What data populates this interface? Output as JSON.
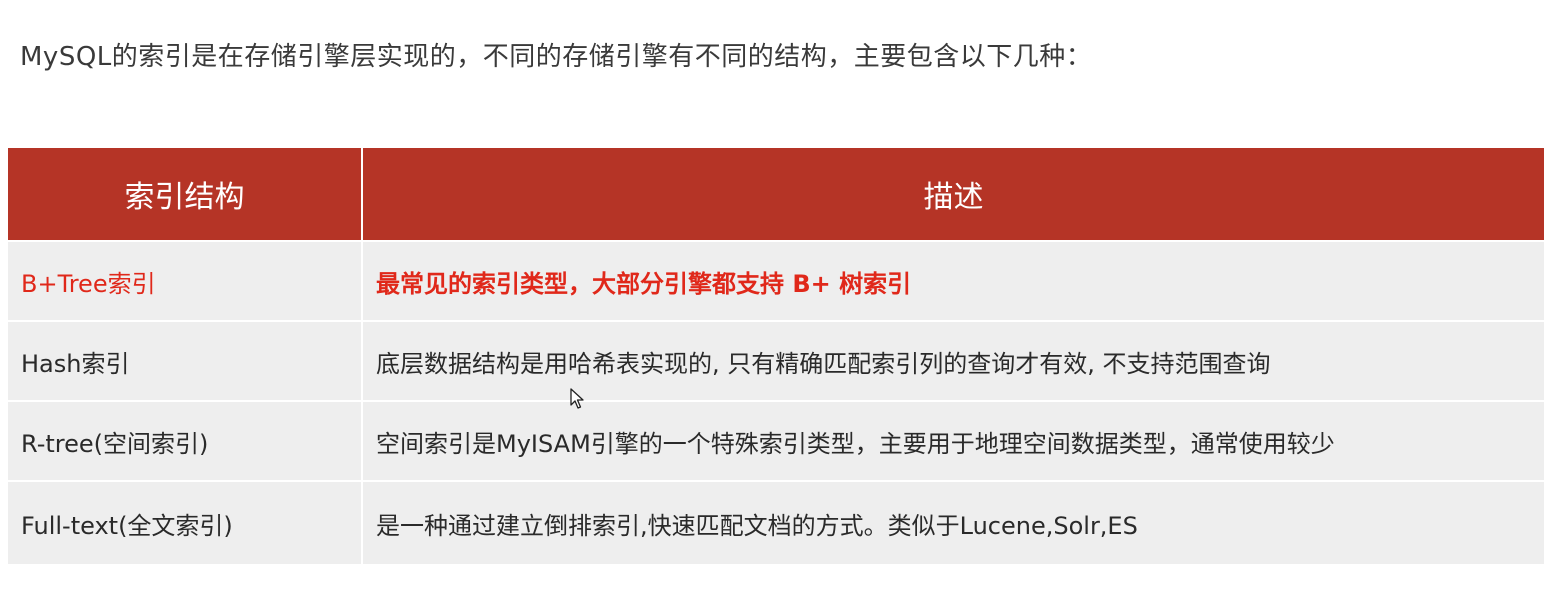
{
  "intro": "MySQL的索引是在存储引擎层实现的，不同的存储引擎有不同的结构，主要包含以下几种：",
  "table": {
    "headers": [
      "索引结构",
      "描述"
    ],
    "rows": [
      {
        "structure": "B+Tree索引",
        "description": "最常见的索引类型，大部分引擎都支持 B+ 树索引",
        "highlight": true
      },
      {
        "structure": "Hash索引",
        "description": "底层数据结构是用哈希表实现的, 只有精确匹配索引列的查询才有效, 不支持范围查询"
      },
      {
        "structure": "R-tree(空间索引)",
        "description": "空间索引是MyISAM引擎的一个特殊索引类型，主要用于地理空间数据类型，通常使用较少"
      },
      {
        "structure": "Full-text(全文索引)",
        "description": "是一种通过建立倒排索引,快速匹配文档的方式。类似于Lucene,Solr,ES"
      }
    ]
  },
  "colors": {
    "header_bg": "#b53426",
    "row_bg": "#eeeeee",
    "highlight_text": "#e0281a"
  },
  "cursor": {
    "icon": "mouse-pointer-icon"
  }
}
